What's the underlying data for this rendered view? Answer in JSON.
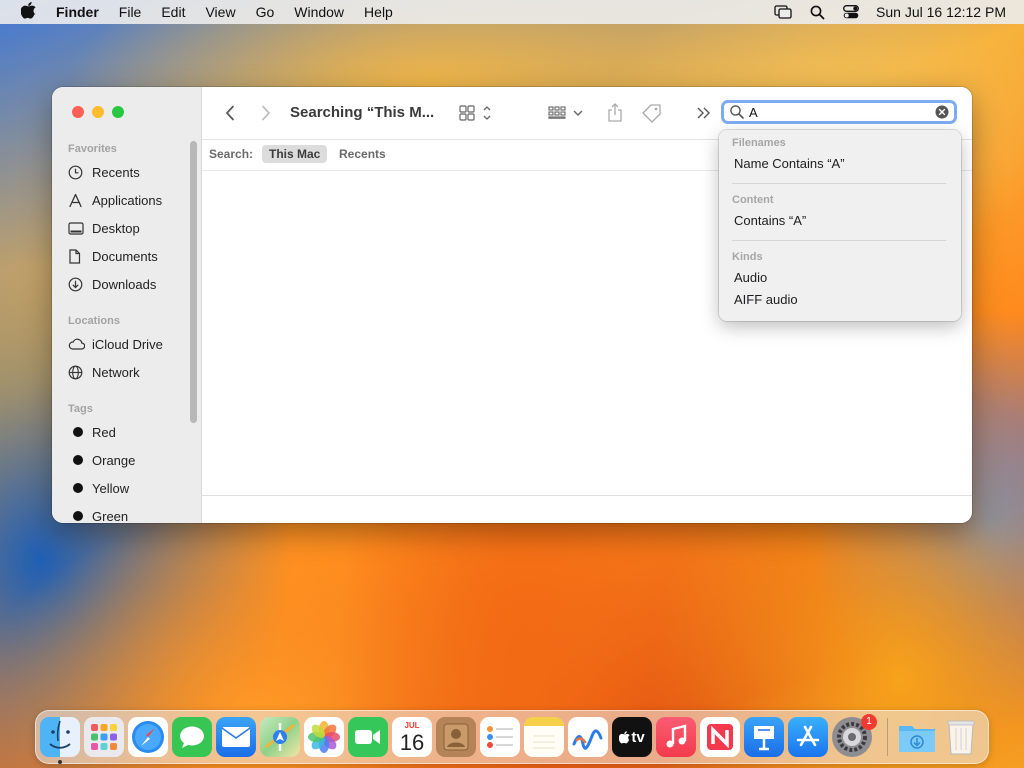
{
  "menubar": {
    "app": "Finder",
    "items": [
      "File",
      "Edit",
      "View",
      "Go",
      "Window",
      "Help"
    ],
    "clock": "Sun Jul 16  12:12 PM"
  },
  "window": {
    "title": "Searching “This M...",
    "sidebar": {
      "favorites_title": "Favorites",
      "favorites": [
        "Recents",
        "Applications",
        "Desktop",
        "Documents",
        "Downloads"
      ],
      "locations_title": "Locations",
      "locations": [
        "iCloud Drive",
        "Network"
      ],
      "tags_title": "Tags",
      "tags": [
        "Red",
        "Orange",
        "Yellow",
        "Green"
      ]
    },
    "search": {
      "value": "A"
    },
    "scope": {
      "label": "Search:",
      "options": [
        "This Mac",
        "Recents"
      ],
      "selected": "This Mac"
    }
  },
  "suggestions": {
    "filenames_title": "Filenames",
    "filenames_item": "Name Contains “A”",
    "content_title": "Content",
    "content_item": "Contains “A”",
    "kinds_title": "Kinds",
    "kinds": [
      "Audio",
      "AIFF audio"
    ]
  },
  "dock": {
    "calendar_month": "JUL",
    "calendar_day": "16",
    "tv_label": "tv",
    "settings_badge": "1",
    "apps": [
      "finder",
      "launchpad",
      "safari",
      "messages",
      "mail",
      "maps",
      "photos",
      "facetime",
      "calendar",
      "contacts",
      "reminders",
      "notes",
      "freeform",
      "tv",
      "music",
      "news",
      "keynote",
      "app-store",
      "system-settings",
      "downloads",
      "trash"
    ]
  },
  "colors": {
    "accent": "#007aff",
    "traffic_red": "#fe5f57",
    "traffic_yellow": "#febc2e",
    "traffic_green": "#28c840",
    "badge": "#f23b30"
  }
}
